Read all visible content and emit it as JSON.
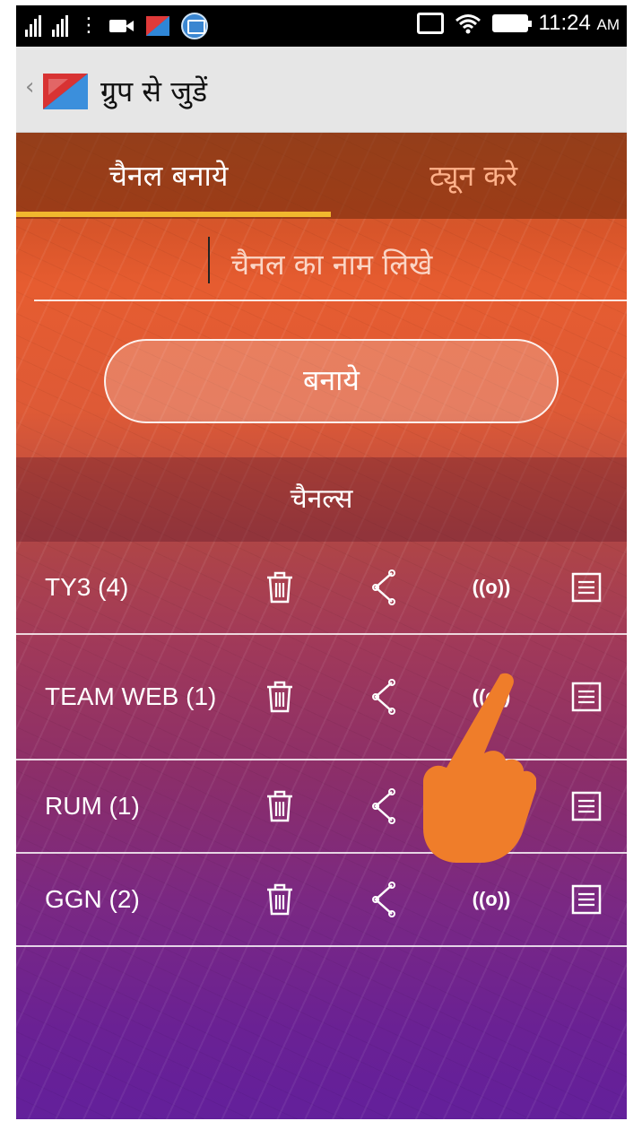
{
  "status_bar": {
    "time": "11:24",
    "ampm": "AM",
    "dots": "⋮",
    "icons": [
      "signal-icon",
      "signal-icon",
      "video-icon",
      "app-icon",
      "app-icon",
      "cast-icon",
      "wifi-icon",
      "battery-icon"
    ]
  },
  "action_bar": {
    "back_glyph": "‹",
    "title": "ग्रुप से जुडें"
  },
  "tabs": [
    {
      "label": "चैनल बनाये",
      "selected": true
    },
    {
      "label": "ट्यून करे",
      "selected": false
    }
  ],
  "form": {
    "name_placeholder": "चैनल का नाम लिखे",
    "create_label": "बनाये"
  },
  "channels_header": "चैनल्स",
  "channels": [
    {
      "name": "TY3 (4)"
    },
    {
      "name": "TEAM WEB (1)"
    },
    {
      "name": "RUM (1)"
    },
    {
      "name": "GGN (2)"
    }
  ],
  "broadcast_glyph": "((o))",
  "colors": {
    "tab_indicator": "#f1b82e",
    "tab_inactive": "#ffb18a",
    "hand": "#ef7d2a",
    "gradient_top": "#e65c30",
    "gradient_bottom": "#63209b"
  }
}
